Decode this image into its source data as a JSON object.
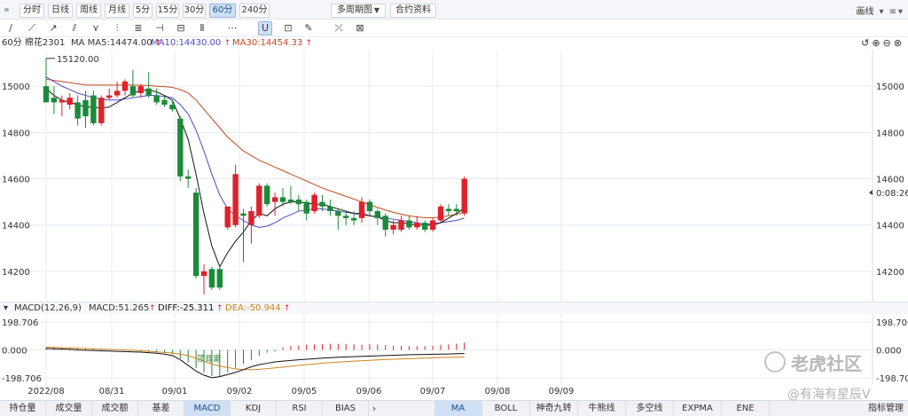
{
  "toolbar": {
    "collapse_icon": "»",
    "periods": [
      "分时",
      "日线",
      "周线",
      "月线",
      "5分",
      "15分",
      "30分",
      "60分",
      "240分"
    ],
    "active_period": "60分",
    "multi_period": "多周期图",
    "contract_info": "合约资料",
    "chart_type": "画线"
  },
  "tools": [
    "pencil-icon",
    "line-icon",
    "ray-icon",
    "parallel-icon",
    "channel-icon",
    "fib-icon",
    "rect-icon",
    "more-icon",
    "magnet-icon",
    "lock-icon",
    "eye-icon",
    "trash-icon",
    "cursor-icon",
    "settings-icon"
  ],
  "legend": {
    "symbol": "60分 棉花2301",
    "ma5": "MA MA5:14474.00",
    "ma10": "MA10:14430.00",
    "ma30": "MA30:14454.33"
  },
  "price_axis": {
    "labels": [
      "15000",
      "14800",
      "14600",
      "14400",
      "14200"
    ],
    "current_tag": "0:08:26",
    "high_marker": "15120.00"
  },
  "macd_legend": {
    "params": "MACD(12,26,9)",
    "macd": "MACD:51.265",
    "diff": "DIFF:-25.311",
    "dea": "DEA:-50.944"
  },
  "macd_axis": {
    "top": "198.706",
    "zero": "0.000",
    "bottom": "-198.706",
    "annotation": "顶背离"
  },
  "dates": [
    "2022/08",
    "08/31",
    "09/01",
    "09/02",
    "09/05",
    "09/06",
    "09/07",
    "09/08",
    "09/09"
  ],
  "indicator_tabs": [
    "持仓量",
    "成交量",
    "成交额",
    "基差",
    "MACD",
    "KDJ",
    "RSI",
    "BIAS"
  ],
  "active_indicator": "MACD",
  "overlay_tabs": [
    "MA",
    "BOLL",
    "神奇九转",
    "牛熊线",
    "多空线",
    "EXPMA",
    "ENE"
  ],
  "active_overlay": "MA",
  "indicator_manage": "指标管理",
  "watermark": "老虎社区",
  "watermark_user": "@有海有星辰V",
  "colors": {
    "up": "#e0202a",
    "down": "#1b8a3a",
    "ma5": "#111111",
    "ma10": "#4a4acb",
    "ma30": "#c4481e",
    "grid": "#e8ebf0"
  },
  "chart_data": {
    "type": "candlestick",
    "ylim": [
      14100,
      15150
    ],
    "candles": [
      {
        "o": 15000,
        "h": 15120,
        "l": 14950,
        "c": 14930
      },
      {
        "o": 14950,
        "h": 15000,
        "l": 14880,
        "c": 14930
      },
      {
        "o": 14930,
        "h": 14960,
        "l": 14870,
        "c": 14940
      },
      {
        "o": 14920,
        "h": 14970,
        "l": 14900,
        "c": 14950
      },
      {
        "o": 14930,
        "h": 14960,
        "l": 14830,
        "c": 14860
      },
      {
        "o": 14940,
        "h": 14980,
        "l": 14820,
        "c": 14870
      },
      {
        "o": 14960,
        "h": 14980,
        "l": 14830,
        "c": 14840
      },
      {
        "o": 14840,
        "h": 14960,
        "l": 14830,
        "c": 14950
      },
      {
        "o": 14950,
        "h": 14990,
        "l": 14940,
        "c": 14960
      },
      {
        "o": 14960,
        "h": 15020,
        "l": 14950,
        "c": 14980
      },
      {
        "o": 14980,
        "h": 15030,
        "l": 14960,
        "c": 15020
      },
      {
        "o": 15000,
        "h": 15070,
        "l": 14950,
        "c": 14960
      },
      {
        "o": 14970,
        "h": 15010,
        "l": 14950,
        "c": 15000
      },
      {
        "o": 14990,
        "h": 15060,
        "l": 14950,
        "c": 14960
      },
      {
        "o": 14960,
        "h": 14990,
        "l": 14920,
        "c": 14930
      },
      {
        "o": 14940,
        "h": 14960,
        "l": 14910,
        "c": 14920
      },
      {
        "o": 14920,
        "h": 14940,
        "l": 14890,
        "c": 14900
      },
      {
        "o": 14860,
        "h": 14870,
        "l": 14590,
        "c": 14610
      },
      {
        "o": 14610,
        "h": 14640,
        "l": 14560,
        "c": 14600
      },
      {
        "o": 14540,
        "h": 14560,
        "l": 14170,
        "c": 14180
      },
      {
        "o": 14180,
        "h": 14230,
        "l": 14100,
        "c": 14200
      },
      {
        "o": 14210,
        "h": 14220,
        "l": 14120,
        "c": 14130
      },
      {
        "o": 14210,
        "h": 14220,
        "l": 14120,
        "c": 14130
      },
      {
        "o": 14390,
        "h": 14470,
        "l": 14380,
        "c": 14480
      },
      {
        "o": 14400,
        "h": 14660,
        "l": 14390,
        "c": 14620
      },
      {
        "o": 14450,
        "h": 14470,
        "l": 14240,
        "c": 14440
      },
      {
        "o": 14400,
        "h": 14480,
        "l": 14320,
        "c": 14460
      },
      {
        "o": 14440,
        "h": 14580,
        "l": 14430,
        "c": 14570
      },
      {
        "o": 14570,
        "h": 14580,
        "l": 14480,
        "c": 14490
      },
      {
        "o": 14500,
        "h": 14540,
        "l": 14440,
        "c": 14520
      },
      {
        "o": 14520,
        "h": 14560,
        "l": 14480,
        "c": 14500
      },
      {
        "o": 14510,
        "h": 14570,
        "l": 14490,
        "c": 14500
      },
      {
        "o": 14510,
        "h": 14530,
        "l": 14460,
        "c": 14490
      },
      {
        "o": 14500,
        "h": 14510,
        "l": 14420,
        "c": 14450
      },
      {
        "o": 14460,
        "h": 14540,
        "l": 14450,
        "c": 14530
      },
      {
        "o": 14500,
        "h": 14530,
        "l": 14460,
        "c": 14480
      },
      {
        "o": 14480,
        "h": 14510,
        "l": 14440,
        "c": 14460
      },
      {
        "o": 14460,
        "h": 14470,
        "l": 14380,
        "c": 14440
      },
      {
        "o": 14440,
        "h": 14460,
        "l": 14400,
        "c": 14430
      },
      {
        "o": 14430,
        "h": 14460,
        "l": 14400,
        "c": 14420
      },
      {
        "o": 14430,
        "h": 14520,
        "l": 14410,
        "c": 14500
      },
      {
        "o": 14500,
        "h": 14510,
        "l": 14440,
        "c": 14460
      },
      {
        "o": 14460,
        "h": 14470,
        "l": 14400,
        "c": 14430
      },
      {
        "o": 14440,
        "h": 14450,
        "l": 14350,
        "c": 14380
      },
      {
        "o": 14380,
        "h": 14420,
        "l": 14360,
        "c": 14400
      },
      {
        "o": 14380,
        "h": 14440,
        "l": 14370,
        "c": 14420
      },
      {
        "o": 14420,
        "h": 14440,
        "l": 14380,
        "c": 14390
      },
      {
        "o": 14390,
        "h": 14440,
        "l": 14380,
        "c": 14410
      },
      {
        "o": 14410,
        "h": 14420,
        "l": 14370,
        "c": 14380
      },
      {
        "o": 14380,
        "h": 14430,
        "l": 14370,
        "c": 14420
      },
      {
        "o": 14420,
        "h": 14490,
        "l": 14410,
        "c": 14480
      },
      {
        "o": 14470,
        "h": 14490,
        "l": 14440,
        "c": 14460
      },
      {
        "o": 14470,
        "h": 14490,
        "l": 14440,
        "c": 14460
      },
      {
        "o": 14450,
        "h": 14610,
        "l": 14440,
        "c": 14600
      }
    ],
    "ma5": [
      14990,
      14960,
      14940,
      14930,
      14920,
      14910,
      14910,
      14905,
      14910,
      14930,
      14950,
      14970,
      14980,
      14985,
      14975,
      14960,
      14940,
      14860,
      14770,
      14620,
      14450,
      14310,
      14220,
      14280,
      14330,
      14370,
      14420,
      14450,
      14440,
      14470,
      14490,
      14500,
      14500,
      14495,
      14490,
      14490,
      14480,
      14470,
      14460,
      14450,
      14450,
      14440,
      14435,
      14420,
      14410,
      14410,
      14405,
      14400,
      14400,
      14400,
      14410,
      14430,
      14450,
      14474
    ],
    "ma10": [
      15040,
      15020,
      15000,
      14985,
      14970,
      14960,
      14950,
      14945,
      14940,
      14940,
      14945,
      14950,
      14955,
      14960,
      14960,
      14955,
      14950,
      14920,
      14880,
      14810,
      14720,
      14620,
      14530,
      14470,
      14440,
      14420,
      14400,
      14390,
      14395,
      14410,
      14430,
      14445,
      14460,
      14465,
      14470,
      14470,
      14465,
      14460,
      14455,
      14450,
      14445,
      14440,
      14435,
      14430,
      14425,
      14420,
      14415,
      14410,
      14405,
      14405,
      14410,
      14415,
      14420,
      14430
    ],
    "ma30": [
      15030,
      15025,
      15020,
      15015,
      15010,
      15005,
      15005,
      15005,
      15005,
      15005,
      15005,
      15005,
      15004,
      15003,
      15000,
      14998,
      14995,
      14985,
      14970,
      14940,
      14900,
      14860,
      14820,
      14780,
      14750,
      14720,
      14700,
      14680,
      14665,
      14650,
      14635,
      14620,
      14605,
      14590,
      14575,
      14560,
      14548,
      14536,
      14524,
      14512,
      14500,
      14488,
      14476,
      14465,
      14455,
      14447,
      14440,
      14435,
      14432,
      14432,
      14434,
      14440,
      14447,
      14454
    ]
  },
  "macd_data": {
    "ylim": [
      -198.706,
      198.706
    ],
    "hist": [
      20,
      18,
      16,
      14,
      10,
      8,
      6,
      4,
      2,
      0,
      -4,
      -6,
      -10,
      -14,
      -18,
      -22,
      -30,
      -60,
      -90,
      -130,
      -160,
      -185,
      -190,
      -160,
      -130,
      -100,
      -70,
      -40,
      -20,
      -10,
      20,
      28,
      32,
      38,
      40,
      42,
      44,
      44,
      42,
      40,
      38,
      40,
      38,
      34,
      30,
      28,
      26,
      26,
      28,
      30,
      36,
      40,
      44,
      52
    ],
    "diff": [
      10,
      8,
      6,
      4,
      0,
      -2,
      -4,
      -6,
      -8,
      -10,
      -12,
      -14,
      -16,
      -20,
      -24,
      -30,
      -40,
      -70,
      -110,
      -150,
      -180,
      -198,
      -190,
      -175,
      -160,
      -140,
      -120,
      -105,
      -95,
      -85,
      -80,
      -75,
      -70,
      -66,
      -62,
      -58,
      -55,
      -52,
      -50,
      -48,
      -46,
      -44,
      -42,
      -40,
      -38,
      -36,
      -34,
      -33,
      -32,
      -31,
      -30,
      -29,
      -27,
      -25
    ],
    "dea": [
      20,
      18,
      16,
      14,
      12,
      10,
      8,
      6,
      4,
      2,
      0,
      -2,
      -6,
      -10,
      -14,
      -18,
      -22,
      -30,
      -40,
      -60,
      -80,
      -100,
      -115,
      -125,
      -135,
      -140,
      -140,
      -138,
      -133,
      -128,
      -122,
      -116,
      -110,
      -105,
      -100,
      -95,
      -91,
      -87,
      -83,
      -80,
      -77,
      -74,
      -71,
      -68,
      -66,
      -64,
      -62,
      -60,
      -58,
      -56,
      -54,
      -53,
      -52,
      -51
    ]
  }
}
